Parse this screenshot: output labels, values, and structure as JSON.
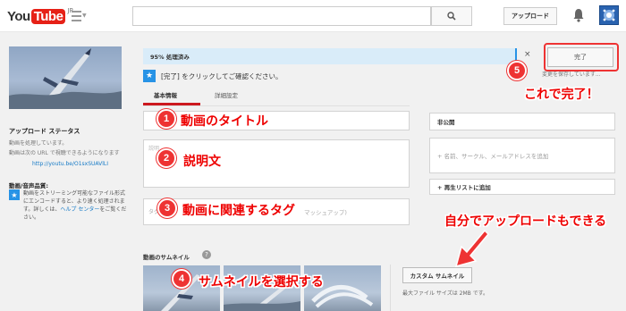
{
  "header": {
    "logo_you": "You",
    "logo_tube": "Tube",
    "logo_region": "JP",
    "upload_label": "アップロード",
    "icons": [
      "guide-menu-icon",
      "search-icon",
      "bell-icon",
      "avatar-icon"
    ]
  },
  "sidebar": {
    "upload_status_title": "アップロード ステータス",
    "processing_text": "動画を処理しています。",
    "url_text": "動画は次の URL で視聴できるようになります",
    "url_link": "http://youtu.be/O1sxSUAVlLI",
    "quality_title": "動画/音声品質:",
    "quality_text": "動画をストリーミング可能なファイル形式にエンコードすると、より速く処理されます。詳しくは、",
    "help_link": "ヘルプ センター",
    "help_suffix": "をご覧ください。"
  },
  "main": {
    "progress_text": "95% 処理済み",
    "progress_percent": 95,
    "close_label": "×",
    "confirm_text": "[完了] をクリックしてご確認ください。",
    "done_label": "完了",
    "saving_text": "変更を保存しています...",
    "tabs": [
      {
        "label": "基本情報"
      },
      {
        "label": "詳細設定"
      }
    ],
    "desc_placeholder": "説明",
    "tag_placeholder": "タグ",
    "tag_placeholder_right": "マッシュアップ)",
    "privacy_label": "非公開",
    "share_placeholder": "+ 名前、サークル、メールアドレスを追加",
    "playlist_label": "+ 再生リストに追加",
    "thumbnails_label": "動画のサムネイル",
    "help_label": "?",
    "custom_thumb_label": "カスタム サムネイル",
    "size_note": "最大ファイル サイズは 2MB です。"
  },
  "annotations": {
    "n1": "1",
    "c1": "動画のタイトル",
    "n2": "2",
    "c2": "説明文",
    "n3": "3",
    "c3": "動画に関連するタグ",
    "n4": "4",
    "c4": "サムネイルを選択する",
    "n5": "5",
    "c5": "これで完了！",
    "upload_note": "自分でアップロードもできる"
  },
  "colors": {
    "accent_red": "#e33333",
    "link_blue": "#167ac6",
    "progress_bg": "#d9ecf9",
    "star_blue": "#2793e6"
  }
}
